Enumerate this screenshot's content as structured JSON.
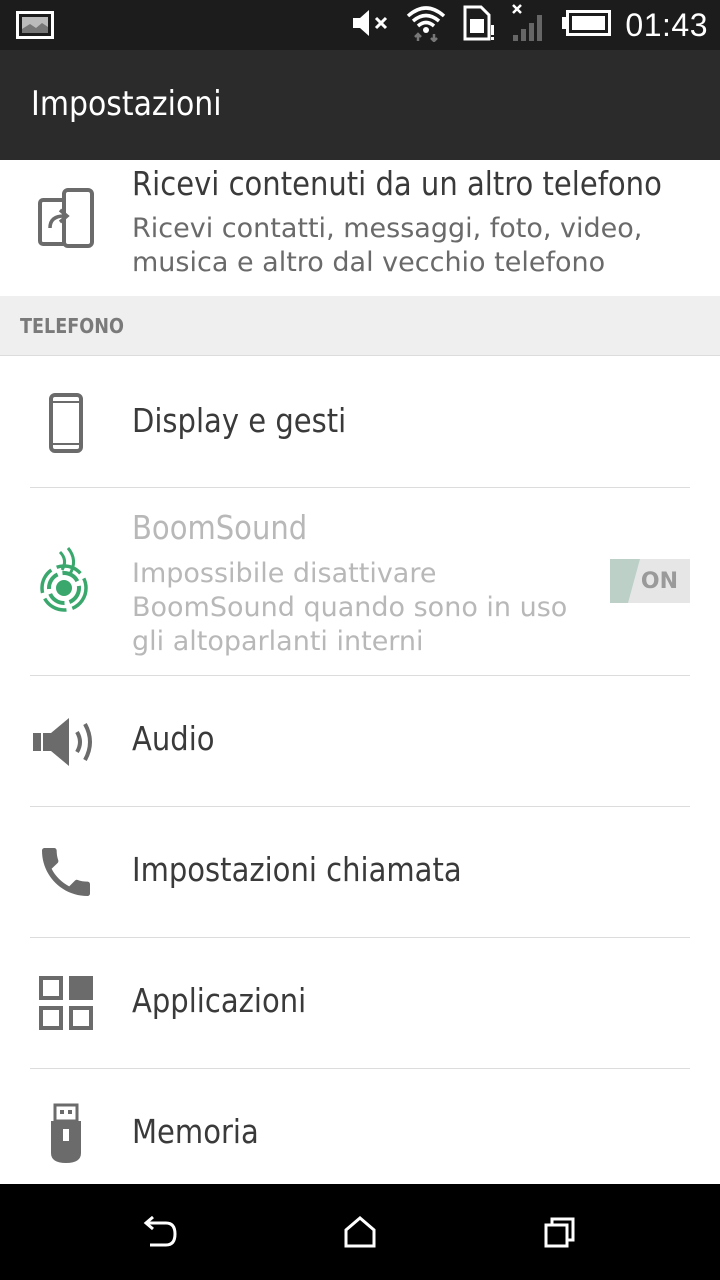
{
  "status_bar": {
    "time": "01:43",
    "icons": [
      "gallery-icon",
      "mute-icon",
      "wifi-icon",
      "sim-icon",
      "signal-icon",
      "battery-icon"
    ]
  },
  "header": {
    "title": "Impostazioni"
  },
  "items": {
    "transfer": {
      "title": "Ricevi contenuti da un altro telefono",
      "subtitle_line1": "Ricevi contatti, messaggi, foto, video,",
      "subtitle_line2": "musica e altro dal vecchio telefono",
      "icon": "phone-transfer-icon"
    },
    "section_phone": "TELEFONO",
    "display": {
      "title": "Display e gesti",
      "icon": "phone-icon"
    },
    "boomsound": {
      "title": "BoomSound",
      "subtitle_line1": "Impossibile disattivare",
      "subtitle_line2": "BoomSound quando sono in uso",
      "subtitle_line3": "gli altoparlanti interni",
      "toggle_label": "ON",
      "icon": "boomsound-icon",
      "accent_color": "#3aa76d"
    },
    "audio": {
      "title": "Audio",
      "icon": "speaker-icon"
    },
    "calls": {
      "title": "Impostazioni chiamata",
      "icon": "phone-handset-icon"
    },
    "apps": {
      "title": "Applicazioni",
      "icon": "apps-grid-icon"
    },
    "storage": {
      "title": "Memoria",
      "icon": "usb-storage-icon"
    }
  },
  "nav": {
    "icons": [
      "back-icon",
      "home-icon",
      "recents-icon"
    ]
  }
}
